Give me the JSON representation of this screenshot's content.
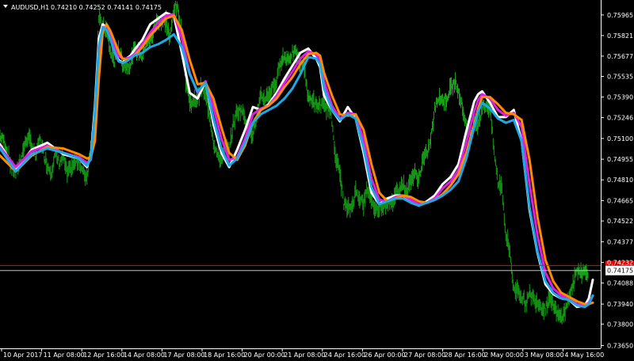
{
  "header": {
    "menu_icon": "triangle-down-icon",
    "symbol": "AUDUSD,H1",
    "ohlc": "0.74210 0.74252 0.74141 0.74175"
  },
  "chart_data": {
    "type": "line",
    "title": "AUDUSD,H1",
    "background": "#000000",
    "grid": false,
    "ylim": [
      0.7363,
      0.7607
    ],
    "y_ticks": [
      "0.75965",
      "0.75821",
      "0.75677",
      "0.75535",
      "0.75390",
      "0.75246",
      "0.75100",
      "0.74955",
      "0.74810",
      "0.74665",
      "0.74522",
      "0.74377",
      "0.74232",
      "0.74088",
      "0.73940",
      "0.73800",
      "0.73650"
    ],
    "x_ticks": [
      "10 Apr 2017",
      "11 Apr 08:00",
      "12 Apr 16:00",
      "14 Apr 08:00",
      "17 Apr 08:00",
      "18 Apr 16:00",
      "20 Apr 00:00",
      "21 Apr 08:00",
      "24 Apr 16:00",
      "26 Apr 00:00",
      "27 Apr 08:00",
      "28 Apr 16:00",
      "2 May 00:00",
      "3 May 08:00",
      "4 May 16:00"
    ],
    "x": [
      0,
      5,
      10,
      15,
      20,
      25,
      30,
      35,
      40,
      45,
      50,
      55,
      60,
      65,
      70,
      75,
      80,
      85,
      90,
      95,
      100,
      105,
      110,
      115,
      120,
      125,
      130,
      135,
      140,
      145,
      150,
      155,
      160,
      165,
      170,
      175,
      180,
      185,
      190,
      195,
      200,
      205,
      210,
      215,
      220,
      225,
      230,
      235,
      240,
      245,
      250,
      255,
      260,
      265,
      270,
      275,
      280,
      285,
      290,
      295,
      300,
      305,
      310,
      315,
      320,
      325,
      330,
      335,
      340,
      345,
      350,
      355,
      360,
      365,
      370,
      375,
      380,
      385,
      390,
      395,
      400,
      405,
      410,
      415,
      420,
      425,
      430,
      435,
      440,
      445,
      450,
      455,
      460,
      465,
      470,
      475,
      480,
      485,
      490,
      495,
      500,
      505,
      510,
      515,
      520,
      525,
      530,
      535,
      540,
      545,
      550,
      555,
      560,
      565,
      570,
      575,
      580,
      585,
      590,
      595,
      600,
      605,
      610,
      615,
      620,
      625,
      630,
      635,
      640,
      645,
      650,
      655,
      660,
      665,
      670,
      675,
      680,
      685,
      690,
      695,
      700,
      705,
      710,
      715,
      720,
      725,
      730,
      735,
      740,
      745,
      750
    ],
    "price": [
      0.7512,
      0.7508,
      0.7498,
      0.749,
      0.7486,
      0.7493,
      0.7503,
      0.7511,
      0.7506,
      0.7497,
      0.7509,
      0.75,
      0.7491,
      0.7487,
      0.7499,
      0.7493,
      0.7497,
      0.7485,
      0.7489,
      0.7493,
      0.7495,
      0.7486,
      0.7483,
      0.7505,
      0.7531,
      0.7593,
      0.7589,
      0.7585,
      0.757,
      0.7564,
      0.7574,
      0.7563,
      0.7561,
      0.7562,
      0.7571,
      0.7572,
      0.7567,
      0.7577,
      0.7578,
      0.7587,
      0.7594,
      0.7591,
      0.7592,
      0.7579,
      0.7603,
      0.76,
      0.7583,
      0.7549,
      0.7536,
      0.7535,
      0.7539,
      0.7546,
      0.754,
      0.7527,
      0.7508,
      0.7498,
      0.7495,
      0.7503,
      0.7501,
      0.752,
      0.7529,
      0.753,
      0.7525,
      0.7516,
      0.7514,
      0.7525,
      0.7539,
      0.7538,
      0.7541,
      0.7546,
      0.755,
      0.7565,
      0.7567,
      0.7566,
      0.757,
      0.7569,
      0.7562,
      0.7561,
      0.7537,
      0.7538,
      0.7532,
      0.7534,
      0.7532,
      0.7532,
      0.7522,
      0.7496,
      0.7486,
      0.7465,
      0.746,
      0.7462,
      0.7473,
      0.7469,
      0.7464,
      0.7475,
      0.7468,
      0.746,
      0.7462,
      0.7463,
      0.7465,
      0.7463,
      0.7471,
      0.7476,
      0.7478,
      0.7472,
      0.7482,
      0.7485,
      0.7482,
      0.7495,
      0.7499,
      0.7509,
      0.753,
      0.754,
      0.7536,
      0.7538,
      0.7545,
      0.7549,
      0.7545,
      0.7531,
      0.7519,
      0.7511,
      0.7523,
      0.7521,
      0.7531,
      0.7534,
      0.7531,
      0.7501,
      0.7479,
      0.7476,
      0.7442,
      0.7431,
      0.7403,
      0.7405,
      0.7399,
      0.7394,
      0.7401,
      0.7398,
      0.7396,
      0.7392,
      0.7391,
      0.7399,
      0.7395,
      0.7386,
      0.7385,
      0.7389,
      0.7399,
      0.7407,
      0.7418,
      0.7417,
      0.7416,
      0.7417
    ],
    "price_color": "#16a016",
    "series": [
      {
        "color": "#ffffff",
        "x": [
          0,
          20,
          40,
          60,
          80,
          100,
          110,
          115,
          120,
          125,
          130,
          135,
          140,
          145,
          150,
          155,
          160,
          165,
          170,
          180,
          190,
          200,
          210,
          220,
          230,
          240,
          250,
          260,
          270,
          280,
          290,
          300,
          310,
          320,
          330,
          340,
          350,
          360,
          370,
          380,
          390,
          400,
          405,
          410,
          420,
          430,
          440,
          450,
          460,
          470,
          480,
          490,
          500,
          510,
          520,
          530,
          540,
          550,
          560,
          570,
          580,
          590,
          600,
          605,
          610,
          620,
          630,
          640,
          650,
          660,
          670,
          680,
          690,
          700,
          710,
          720,
          730,
          740,
          745,
          750
        ],
        "values": [
          0.7506,
          0.7488,
          0.7502,
          0.7507,
          0.7499,
          0.7496,
          0.749,
          0.7498,
          0.7532,
          0.758,
          0.759,
          0.7588,
          0.758,
          0.757,
          0.7565,
          0.7563,
          0.7566,
          0.7568,
          0.7572,
          0.7579,
          0.759,
          0.7594,
          0.7598,
          0.7596,
          0.757,
          0.7542,
          0.7538,
          0.755,
          0.752,
          0.75,
          0.749,
          0.7502,
          0.7516,
          0.7532,
          0.753,
          0.7534,
          0.7542,
          0.7552,
          0.7561,
          0.757,
          0.7573,
          0.7566,
          0.756,
          0.754,
          0.753,
          0.7522,
          0.7532,
          0.7524,
          0.75,
          0.7472,
          0.7464,
          0.7468,
          0.747,
          0.747,
          0.7465,
          0.7463,
          0.7466,
          0.747,
          0.7478,
          0.7483,
          0.7492,
          0.7515,
          0.7536,
          0.7541,
          0.7543,
          0.7535,
          0.7525,
          0.7525,
          0.753,
          0.7508,
          0.746,
          0.743,
          0.7408,
          0.7401,
          0.7398,
          0.7397,
          0.7392,
          0.7393,
          0.7398,
          0.7411
        ]
      },
      {
        "color": "#e020e0",
        "x": [
          0,
          20,
          40,
          60,
          80,
          100,
          110,
          115,
          120,
          125,
          130,
          135,
          140,
          145,
          150,
          155,
          160,
          165,
          170,
          180,
          190,
          200,
          210,
          220,
          230,
          240,
          250,
          260,
          270,
          280,
          290,
          300,
          310,
          320,
          330,
          340,
          350,
          360,
          370,
          380,
          390,
          400,
          405,
          410,
          420,
          430,
          440,
          450,
          460,
          470,
          480,
          490,
          500,
          510,
          520,
          530,
          540,
          550,
          560,
          570,
          580,
          590,
          600,
          605,
          610,
          620,
          630,
          640,
          650,
          660,
          670,
          680,
          690,
          700,
          710,
          720,
          730,
          740,
          745,
          750
        ],
        "values": [
          0.7504,
          0.749,
          0.7501,
          0.7505,
          0.75,
          0.7497,
          0.7493,
          0.7495,
          0.752,
          0.7565,
          0.7588,
          0.7588,
          0.7583,
          0.7575,
          0.7568,
          0.7566,
          0.7566,
          0.7567,
          0.7569,
          0.7576,
          0.7584,
          0.7591,
          0.7596,
          0.7597,
          0.758,
          0.7556,
          0.7542,
          0.755,
          0.7532,
          0.751,
          0.7495,
          0.7497,
          0.751,
          0.7527,
          0.7531,
          0.7533,
          0.754,
          0.7549,
          0.7557,
          0.7566,
          0.7571,
          0.7569,
          0.7565,
          0.755,
          0.7533,
          0.7524,
          0.7528,
          0.7527,
          0.7509,
          0.7482,
          0.7467,
          0.7466,
          0.7469,
          0.747,
          0.7467,
          0.7464,
          0.7465,
          0.7468,
          0.7475,
          0.748,
          0.7488,
          0.7507,
          0.7529,
          0.7537,
          0.7541,
          0.7538,
          0.753,
          0.7526,
          0.7528,
          0.7518,
          0.7478,
          0.7442,
          0.7416,
          0.7405,
          0.74,
          0.7398,
          0.7394,
          0.7393,
          0.7395,
          0.74
        ]
      },
      {
        "color": "#ff8c00",
        "x": [
          0,
          20,
          40,
          60,
          80,
          100,
          110,
          115,
          120,
          125,
          130,
          135,
          140,
          145,
          150,
          155,
          160,
          165,
          170,
          180,
          190,
          200,
          210,
          220,
          230,
          240,
          250,
          260,
          270,
          280,
          290,
          300,
          310,
          320,
          330,
          340,
          350,
          360,
          370,
          380,
          390,
          400,
          405,
          410,
          420,
          430,
          440,
          450,
          460,
          470,
          480,
          490,
          500,
          510,
          520,
          530,
          540,
          550,
          560,
          570,
          580,
          590,
          600,
          605,
          610,
          620,
          630,
          640,
          650,
          660,
          670,
          680,
          690,
          700,
          710,
          720,
          730,
          740,
          745,
          750
        ],
        "values": [
          0.7498,
          0.7487,
          0.7498,
          0.7504,
          0.7503,
          0.7499,
          0.7496,
          0.7497,
          0.7508,
          0.7552,
          0.7585,
          0.759,
          0.7585,
          0.7578,
          0.7571,
          0.7566,
          0.7565,
          0.7566,
          0.7568,
          0.7574,
          0.7582,
          0.7588,
          0.7594,
          0.7596,
          0.7586,
          0.7565,
          0.7548,
          0.7549,
          0.7538,
          0.7518,
          0.75,
          0.7495,
          0.7505,
          0.7521,
          0.753,
          0.7533,
          0.7538,
          0.7546,
          0.7553,
          0.7562,
          0.7569,
          0.757,
          0.7568,
          0.7556,
          0.754,
          0.7527,
          0.7526,
          0.7527,
          0.7516,
          0.7492,
          0.7472,
          0.7466,
          0.7468,
          0.747,
          0.7469,
          0.7466,
          0.7465,
          0.7467,
          0.7471,
          0.7477,
          0.7485,
          0.75,
          0.752,
          0.7531,
          0.7539,
          0.7539,
          0.7534,
          0.7528,
          0.7527,
          0.7523,
          0.7495,
          0.7455,
          0.7425,
          0.741,
          0.7402,
          0.7399,
          0.7396,
          0.7394,
          0.7394,
          0.7395
        ]
      },
      {
        "color": "#1ea8e8",
        "x": [
          0,
          20,
          40,
          60,
          80,
          100,
          110,
          115,
          120,
          125,
          130,
          135,
          140,
          145,
          150,
          155,
          160,
          165,
          170,
          180,
          190,
          200,
          210,
          220,
          230,
          240,
          250,
          260,
          270,
          280,
          290,
          300,
          310,
          320,
          330,
          340,
          350,
          360,
          370,
          380,
          390,
          400,
          405,
          410,
          420,
          430,
          440,
          450,
          460,
          470,
          480,
          490,
          500,
          510,
          520,
          530,
          540,
          550,
          560,
          570,
          580,
          590,
          600,
          605,
          610,
          620,
          630,
          640,
          650,
          660,
          670,
          680,
          690,
          700,
          710,
          720,
          730,
          740,
          745,
          750
        ],
        "values": [
          0.7503,
          0.7487,
          0.7499,
          0.7503,
          0.75,
          0.7496,
          0.7491,
          0.7496,
          0.7528,
          0.7575,
          0.7588,
          0.7586,
          0.7579,
          0.757,
          0.7564,
          0.7563,
          0.7564,
          0.7566,
          0.7568,
          0.757,
          0.7574,
          0.7576,
          0.7579,
          0.7583,
          0.7574,
          0.7555,
          0.7543,
          0.7549,
          0.7524,
          0.7503,
          0.7491,
          0.7496,
          0.7507,
          0.7521,
          0.7527,
          0.753,
          0.7533,
          0.7538,
          0.7545,
          0.7555,
          0.7567,
          0.7566,
          0.7562,
          0.7545,
          0.753,
          0.7523,
          0.7527,
          0.7524,
          0.7503,
          0.7476,
          0.7464,
          0.7466,
          0.7468,
          0.7468,
          0.7465,
          0.7463,
          0.7465,
          0.7467,
          0.747,
          0.7474,
          0.748,
          0.7496,
          0.7518,
          0.7529,
          0.7535,
          0.7531,
          0.7524,
          0.7521,
          0.7523,
          0.7508,
          0.7462,
          0.7431,
          0.741,
          0.7402,
          0.7398,
          0.7397,
          0.7393,
          0.7392,
          0.7394,
          0.74
        ]
      }
    ],
    "hlines": [
      {
        "value": 0.7421,
        "color": "#ff0000",
        "label": "0.74210",
        "label_bg": "#ff0000",
        "label_fg": "#000000"
      },
      {
        "value": 0.74175,
        "color": "#c0c0c0",
        "label": "0.74175",
        "label_bg": "#ffffff",
        "label_fg": "#000000"
      }
    ]
  }
}
